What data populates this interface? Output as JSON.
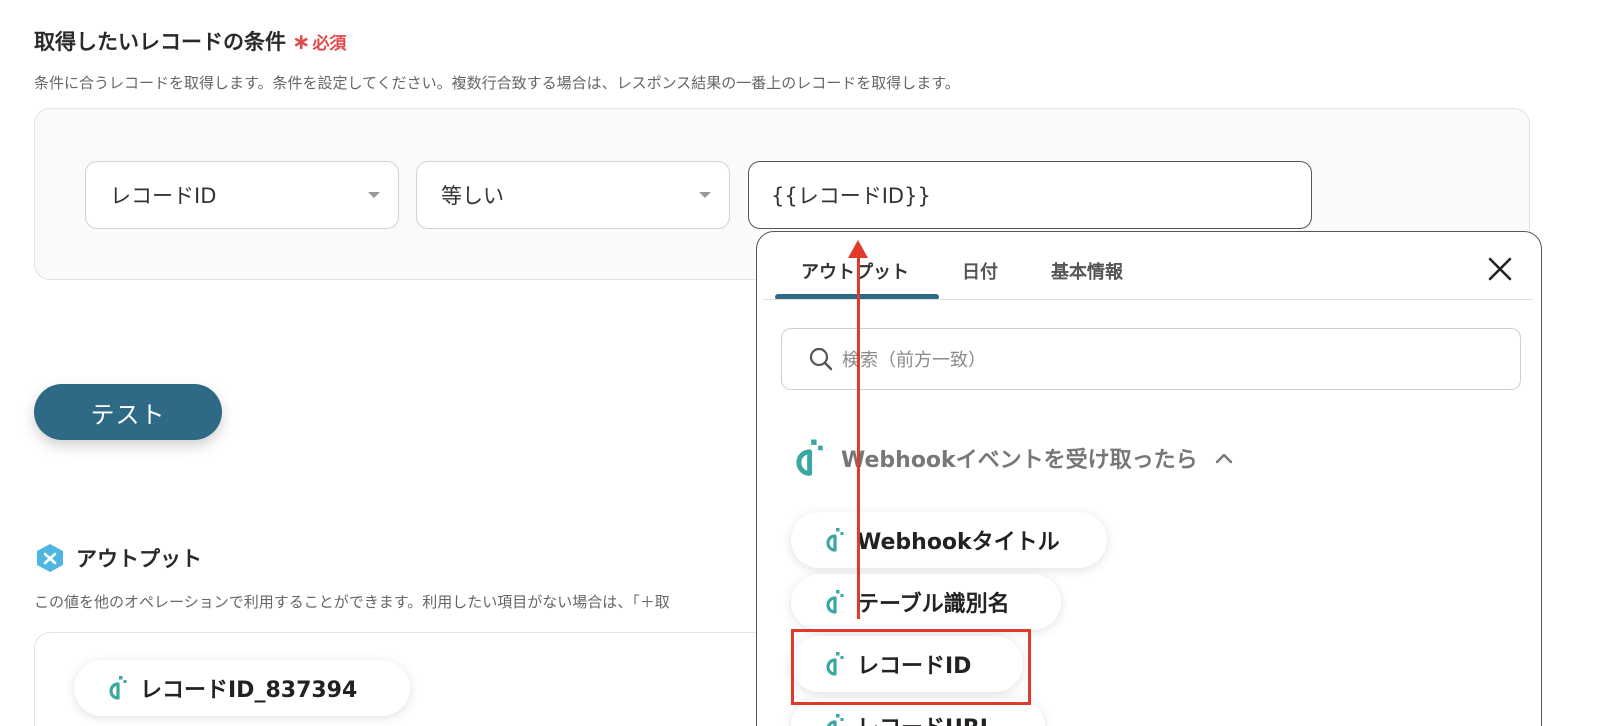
{
  "condition": {
    "title": "取得したいレコードの条件",
    "required_label": "必須",
    "required_star": "∗",
    "description": "条件に合うレコードを取得します。条件を設定してください。複数行合致する場合は、レスポンス結果の一番上のレコードを取得します。",
    "field_select": "レコードID",
    "operator_select": "等しい",
    "value": "{{レコードID}}"
  },
  "test_button": "テスト",
  "output": {
    "title": "アウトプット",
    "description": "この値を他のオペレーションで利用することができます。利用したい項目がない場合は、「＋取",
    "items": [
      "レコードID_837394"
    ]
  },
  "popup": {
    "tabs": [
      "アウトプット",
      "日付",
      "基本情報"
    ],
    "active_tab": "アウトプット",
    "search_placeholder": "検索（前方一致）",
    "group_title": "Webhookイベントを受け取ったら",
    "items": [
      "Webhookタイトル",
      "テーブル識別名",
      "レコードID",
      "レコードURL"
    ],
    "highlighted_item": "レコードID"
  },
  "colors": {
    "accent": "#2e6a85",
    "required": "#e04a4a",
    "annotation": "#e03a2a",
    "yoom_icon": "#3aa7a0"
  },
  "icons": [
    "chevron-down-icon",
    "close-icon",
    "search-icon",
    "yoom-app-icon",
    "output-icon",
    "chevron-up-icon"
  ]
}
